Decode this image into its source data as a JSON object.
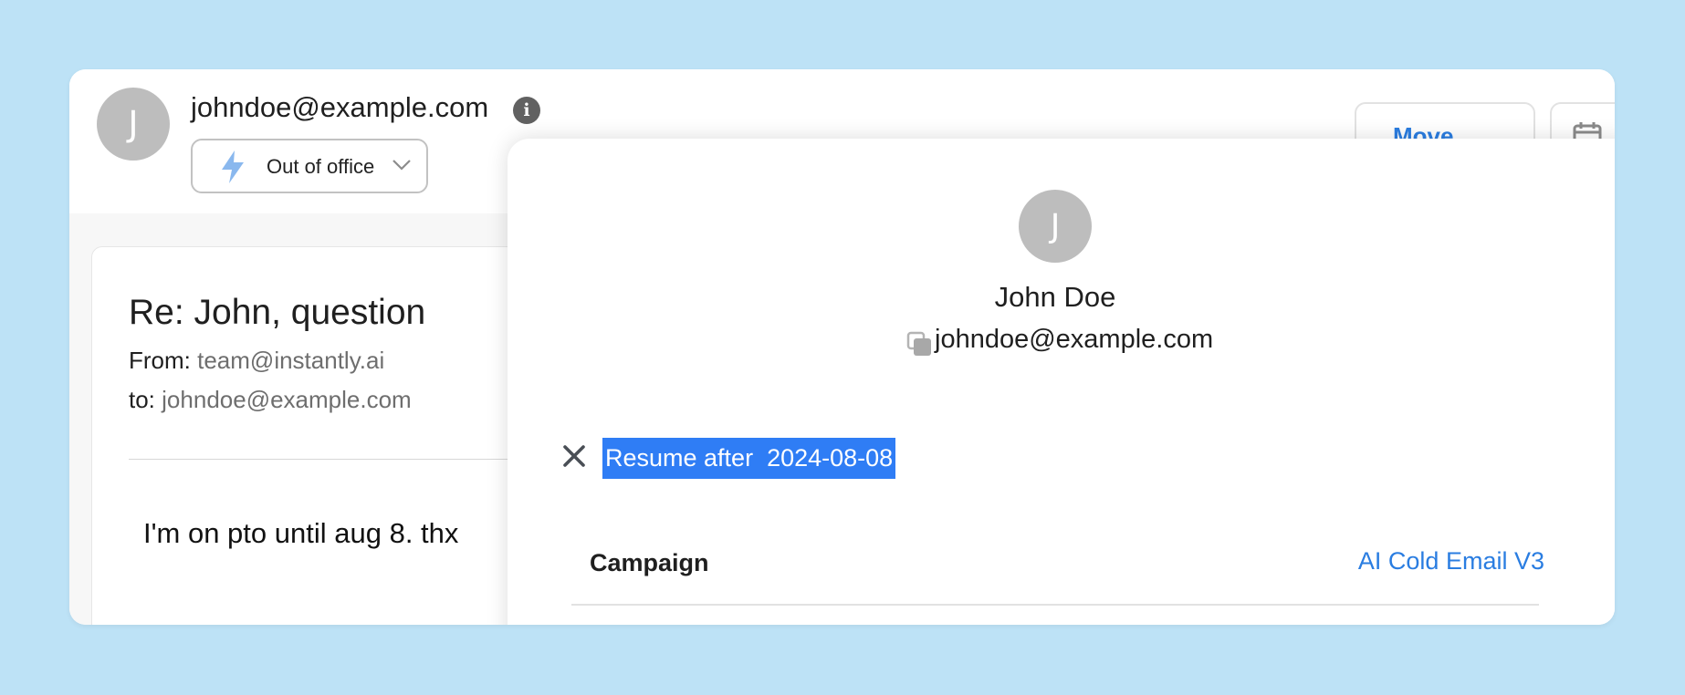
{
  "header": {
    "avatar_initial": "J",
    "email": "johndoe@example.com",
    "status": "Out of office",
    "move_label": "Move"
  },
  "email": {
    "subject": "Re: John, question",
    "from_label": "From:",
    "from_value": "team@instantly.ai",
    "to_label": "to:",
    "to_value": "johndoe@example.com",
    "body": "I'm on pto until aug 8. thx"
  },
  "contact_panel": {
    "avatar_initial": "J",
    "name": "John Doe",
    "email": "johndoe@example.com",
    "resume_text": "Resume after  2024-08-08",
    "campaign_label": "Campaign",
    "campaign_value": "AI Cold Email V3"
  },
  "colors": {
    "background": "#bde2f6",
    "accent": "#2a7de1",
    "selection": "#2f7df5",
    "avatar": "#bdbdbd"
  },
  "icons": [
    "info-icon",
    "bolt-icon",
    "chevron-down-icon",
    "calendar-icon",
    "copy-icon",
    "close-icon"
  ]
}
